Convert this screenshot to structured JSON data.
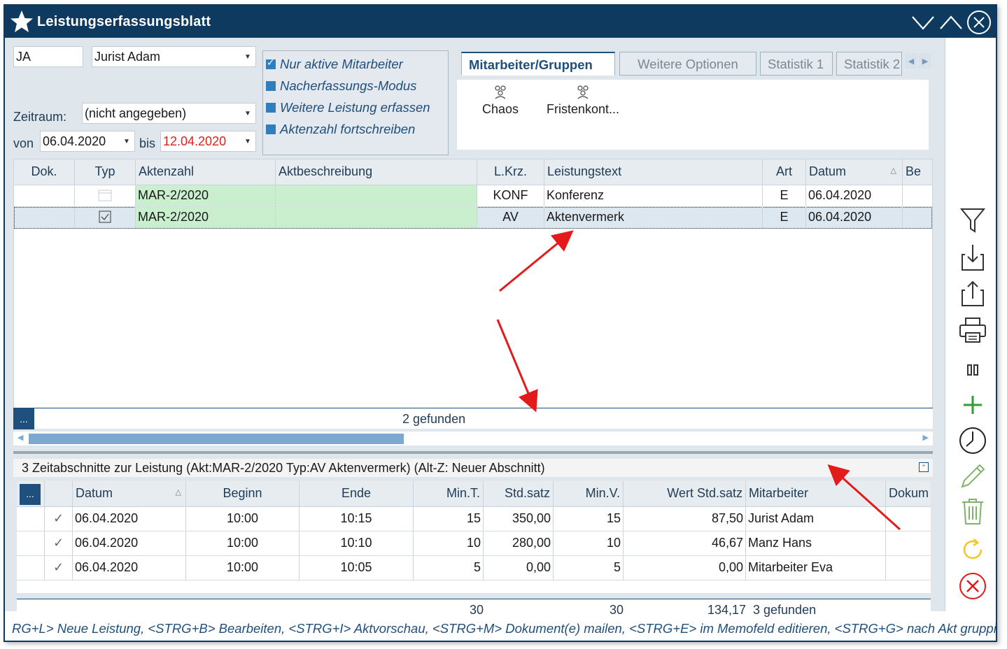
{
  "window": {
    "title": "Leistungserfassungsblatt"
  },
  "filters": {
    "user_code": "JA",
    "user_name": "Jurist Adam",
    "zeitraum_label": "Zeitraum:",
    "zeitraum_value": "(nicht angegeben)",
    "von_label": "von",
    "von_value": "06.04.2020",
    "bis_label": "bis",
    "bis_value": "12.04.2020"
  },
  "options": [
    {
      "label": "Nur aktive Mitarbeiter",
      "checked": true
    },
    {
      "label": "Nacherfassungs-Modus",
      "checked": false
    },
    {
      "label": "Weitere Leistung erfassen",
      "checked": false
    },
    {
      "label": "Aktenzahl fortschreiben",
      "checked": false
    }
  ],
  "tabs": [
    {
      "label": "Mitarbeiter/Gruppen",
      "active": true
    },
    {
      "label": "Weitere Optionen",
      "active": false
    },
    {
      "label": "Statistik 1",
      "active": false
    },
    {
      "label": "Statistik 2",
      "active": false
    }
  ],
  "groups": [
    {
      "label": "Chaos"
    },
    {
      "label": "Fristenkont..."
    }
  ],
  "main_grid": {
    "columns": [
      "Dok.",
      "Typ",
      "Aktenzahl",
      "Aktbeschreibung",
      "L.Krz.",
      "Leistungstext",
      "Art",
      "Datum",
      "Be"
    ],
    "rows": [
      {
        "dok": "",
        "typ": "",
        "aktenzahl": "MAR-2/2020",
        "aktbeschreibung": "",
        "lkrz": "KONF",
        "leistungstext": "Konferenz",
        "art": "E",
        "datum": "06.04.2020"
      },
      {
        "dok": "",
        "typ": "",
        "aktenzahl": "MAR-2/2020",
        "aktbeschreibung": "",
        "lkrz": "AV",
        "leistungstext": "Aktenvermerk",
        "art": "E",
        "datum": "06.04.2020"
      }
    ],
    "found": "2 gefunden",
    "dots": "..."
  },
  "sub_section": {
    "title": "3 Zeitabschnitte zur Leistung (Akt:MAR-2/2020   Typ:AV Aktenvermerk) (Alt-Z: Neuer Abschnitt)",
    "columns": [
      "...",
      "Datum",
      "Beginn",
      "Ende",
      "Min.T.",
      "Std.satz",
      "Min.V.",
      "Wert Std.satz",
      "Mitarbeiter",
      "Dokum"
    ],
    "rows": [
      {
        "check": "✓",
        "datum": "06.04.2020",
        "beginn": "10:00",
        "ende": "10:15",
        "mint": "15",
        "stdsatz": "350,00",
        "minv": "15",
        "wert": "87,50",
        "mitarbeiter": "Jurist Adam"
      },
      {
        "check": "✓",
        "datum": "06.04.2020",
        "beginn": "10:00",
        "ende": "10:10",
        "mint": "10",
        "stdsatz": "280,00",
        "minv": "10",
        "wert": "46,67",
        "mitarbeiter": "Manz Hans"
      },
      {
        "check": "✓",
        "datum": "06.04.2020",
        "beginn": "10:00",
        "ende": "10:05",
        "mint": "5",
        "stdsatz": "0,00",
        "minv": "5",
        "wert": "0,00",
        "mitarbeiter": "Mitarbeiter Eva"
      }
    ],
    "sum_mint": "30",
    "sum_minv": "30",
    "sum_wert": "134,17",
    "found": "3 gefunden"
  },
  "statusbar": "RG+L> Neue Leistung, <STRG+B> Bearbeiten, <STRG+I> Aktvorschau, <STRG+M> Dokument(e) mailen, <STRG+E> im Memofeld editieren, <STRG+G> nach Akt gruppie",
  "sidebar_icons": [
    "filter-icon",
    "import-icon",
    "export-icon",
    "print-icon",
    "columns-icon",
    "add-icon",
    "clock-icon",
    "edit-icon",
    "delete-icon",
    "refresh-icon",
    "cancel-icon"
  ],
  "colors": {
    "titlebar": "#0f3a5f",
    "accent": "#1f4f7d",
    "green_cell": "#c9efcf",
    "red_date": "#e0201c",
    "add_green": "#2e9e2e",
    "refresh_yellow": "#f3c623",
    "cancel_red": "#e01818"
  }
}
